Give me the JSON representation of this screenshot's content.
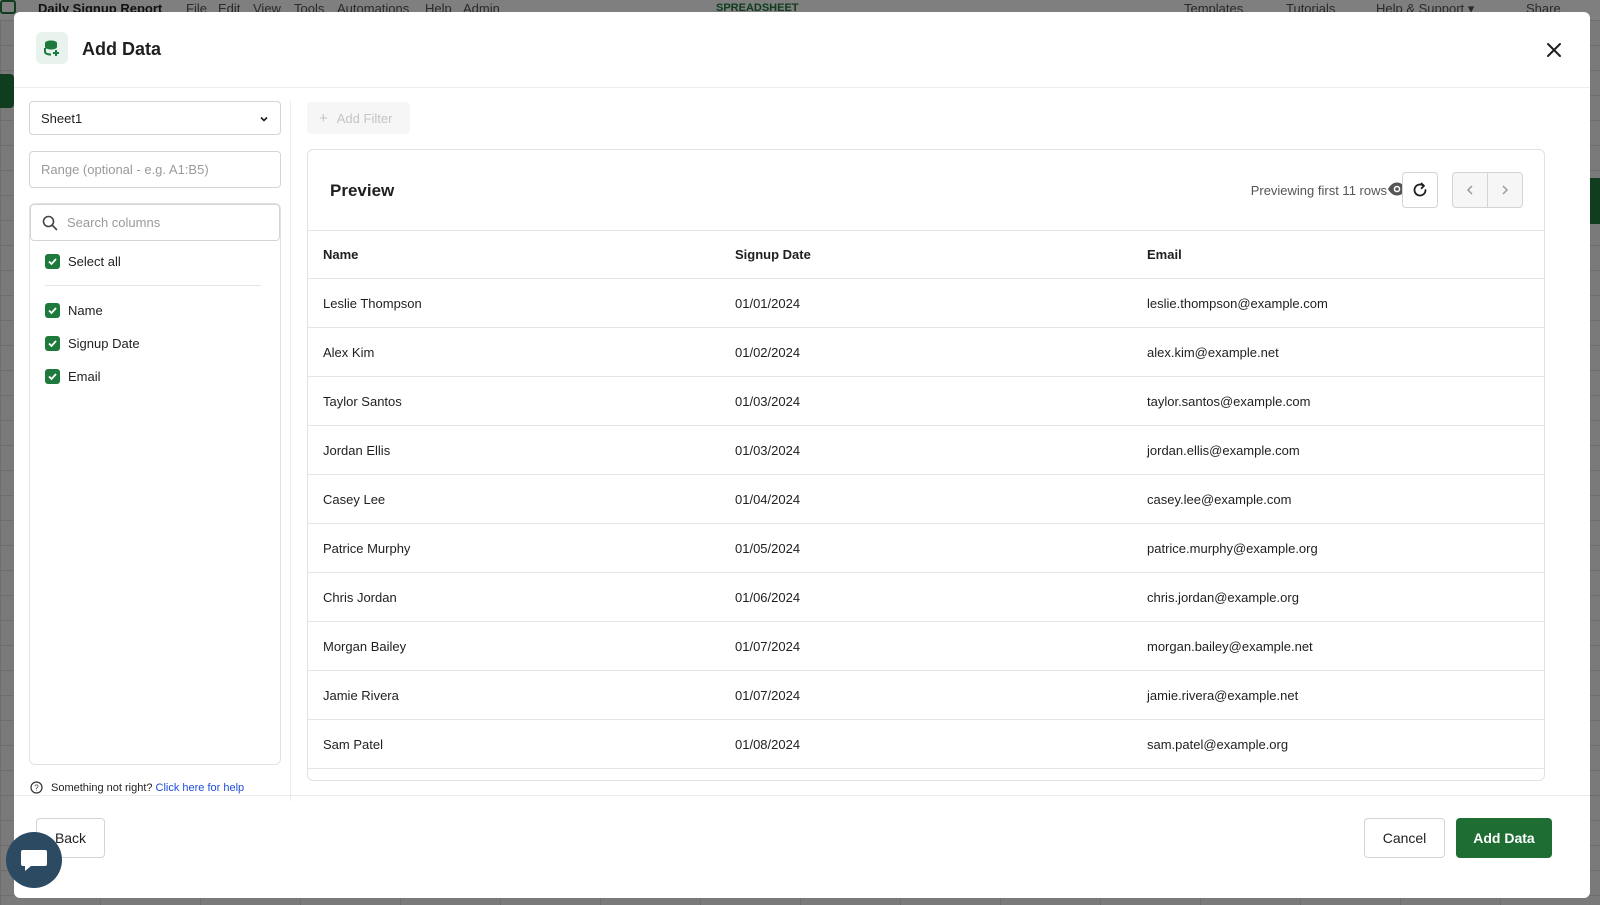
{
  "background": {
    "doc_title": "Daily Signup Report",
    "menu": [
      "File",
      "Edit",
      "View",
      "Tools",
      "Automations",
      "Help",
      "Admin"
    ],
    "spreadsheet_label": "SPREADSHEET",
    "right_links": [
      "Templates",
      "Tutorials",
      "Help & Support ▾",
      "Share"
    ]
  },
  "modal": {
    "title": "Add Data",
    "sheet_select": {
      "value": "Sheet1"
    },
    "range_input": {
      "placeholder": "Range (optional - e.g. A1:B5)"
    },
    "column_search": {
      "placeholder": "Search columns"
    },
    "select_all_label": "Select all",
    "columns": [
      {
        "label": "Name",
        "checked": true
      },
      {
        "label": "Signup Date",
        "checked": true
      },
      {
        "label": "Email",
        "checked": true
      }
    ],
    "help": {
      "text": "Something not right?",
      "link": "Click here for help"
    },
    "add_filter_label": "Add Filter",
    "preview": {
      "title": "Preview",
      "info": "Previewing first 11 rows",
      "headers": [
        "Name",
        "Signup Date",
        "Email"
      ],
      "rows": [
        [
          "Leslie Thompson",
          "01/01/2024",
          "leslie.thompson@example.com"
        ],
        [
          "Alex Kim",
          "01/02/2024",
          "alex.kim@example.net"
        ],
        [
          "Taylor Santos",
          "01/03/2024",
          "taylor.santos@example.com"
        ],
        [
          "Jordan Ellis",
          "01/03/2024",
          "jordan.ellis@example.com"
        ],
        [
          "Casey Lee",
          "01/04/2024",
          "casey.lee@example.com"
        ],
        [
          "Patrice Murphy",
          "01/05/2024",
          "patrice.murphy@example.org"
        ],
        [
          "Chris Jordan",
          "01/06/2024",
          "chris.jordan@example.org"
        ],
        [
          "Morgan Bailey",
          "01/07/2024",
          "morgan.bailey@example.net"
        ],
        [
          "Jamie Rivera",
          "01/07/2024",
          "jamie.rivera@example.net"
        ],
        [
          "Sam Patel",
          "01/08/2024",
          "sam.patel@example.org"
        ]
      ]
    },
    "footer": {
      "back_label": "Back",
      "cancel_label": "Cancel",
      "add_label": "Add Data"
    }
  },
  "colors": {
    "accent": "#1e6e34",
    "link": "#1d4ed8"
  }
}
